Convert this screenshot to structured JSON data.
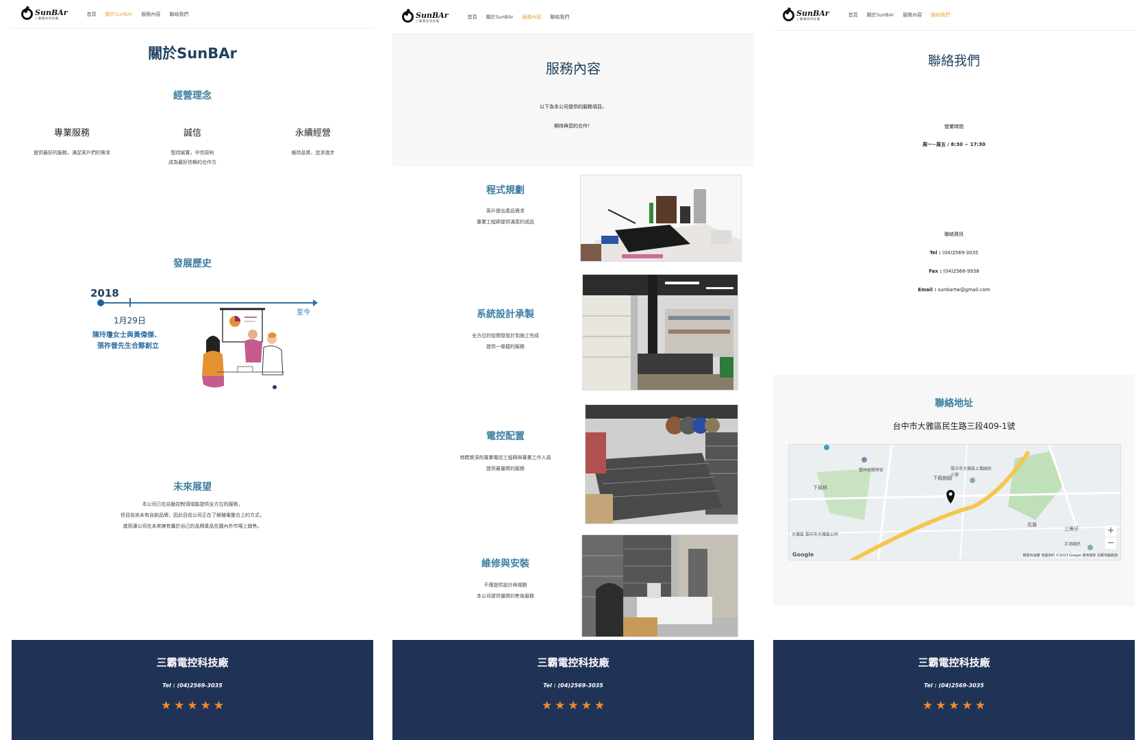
{
  "brand": {
    "name": "SunBAr",
    "sub": "三霸電控科技廠"
  },
  "panels": [
    {
      "nav": [
        "首頁",
        "關於SunBAr",
        "服務內容",
        "聯絡我們"
      ],
      "active": 1
    },
    {
      "nav": [
        "首頁",
        "關於SunBAr",
        "服務內容",
        "聯絡我們"
      ],
      "active": 2
    },
    {
      "nav": [
        "首頁",
        "關於SunBAr",
        "服務內容",
        "聯絡我們"
      ],
      "active": 3
    }
  ],
  "about": {
    "title": "關於SunBAr",
    "philosophy": "經營理念",
    "values": [
      {
        "title": "專業服務",
        "lines": [
          "提供最好的服務，滿足客戶們的需求"
        ]
      },
      {
        "title": "誠信",
        "lines": [
          "堅持誠實，守信原則",
          "成為最好信賴的合作方"
        ]
      },
      {
        "title": "永續經營",
        "lines": [
          "維持品質，追求進步"
        ]
      }
    ],
    "history_title": "發展歷史",
    "year": "2018",
    "date": "1月29日",
    "founders": [
      "陳玲瓊女士與黃偉傑、",
      "張祚晉先生合夥創立"
    ],
    "until": "至今",
    "future_title": "未來展望",
    "future_lines": [
      "本公司已在自動控制領域能提供全方位的服務，",
      "但目前尚未有自創品牌，因此目前公司正在了解機電整合上的方式，",
      "進而讓公司在未來擁有屬於自己的品牌產品在國內外市場上銷售。"
    ]
  },
  "services": {
    "title": "服務內容",
    "intro": [
      "以下為本公司提供的服務項目，",
      "期待與您的合作！"
    ],
    "items": [
      {
        "title": "程式規劃",
        "lines": [
          "客戶提出產品需求",
          "專業工程師提供滿意的成品"
        ]
      },
      {
        "title": "系統設計承製",
        "lines": [
          "全方位的從開發設計到施工完成",
          "提供一條龍的服務"
        ]
      },
      {
        "title": "電控配置",
        "lines": [
          "特聘資深的專業電控工程師與專業工作人員",
          "提供最優質的服務"
        ]
      },
      {
        "title": "維修與安裝",
        "lines": [
          "不僅提供設計與規劃",
          "本公司提供優質的售後服務"
        ]
      }
    ]
  },
  "contact": {
    "title": "聯絡我們",
    "hours_label": "營業時間",
    "hours": "周一~周五 / 8:30 ~ 17:30",
    "info_label": "聯絡資訊",
    "tel_label": "Tel :",
    "tel": "(04)2569-3035",
    "fax_label": "Fax :",
    "fax": "(04)2568-9938",
    "email_label": "Email :",
    "email": "sunbartw@gmail.com",
    "address_title": "聯絡地址",
    "address": "台中市大雅區民生路三段409-1號",
    "map_labels": [
      "下員林",
      "下楓樹腳",
      "大雅區 雲中市大雅區公所",
      "花眉",
      "三角仔",
      "正湳國民",
      "豐林宮勝興宮",
      "雲中市大雅區上楓國民小學"
    ],
    "map_credit": "鍵盤快速鍵  地圖資料 ©2023 Google  使用條款  回報地圖錯誤",
    "zoom_in": "+",
    "zoom_out": "−",
    "google": "Google"
  },
  "footer": {
    "name": "三霸電控科技廠",
    "tel": "Tel : (04)2569-3035",
    "stars": [
      "★",
      "★",
      "★",
      "★",
      "★"
    ]
  },
  "colors": {
    "title": "#1f4160",
    "accent": "#3d7fa1",
    "nav_active": "#e8a23a",
    "footer_bg": "#203357",
    "star": "#f28a2e"
  }
}
